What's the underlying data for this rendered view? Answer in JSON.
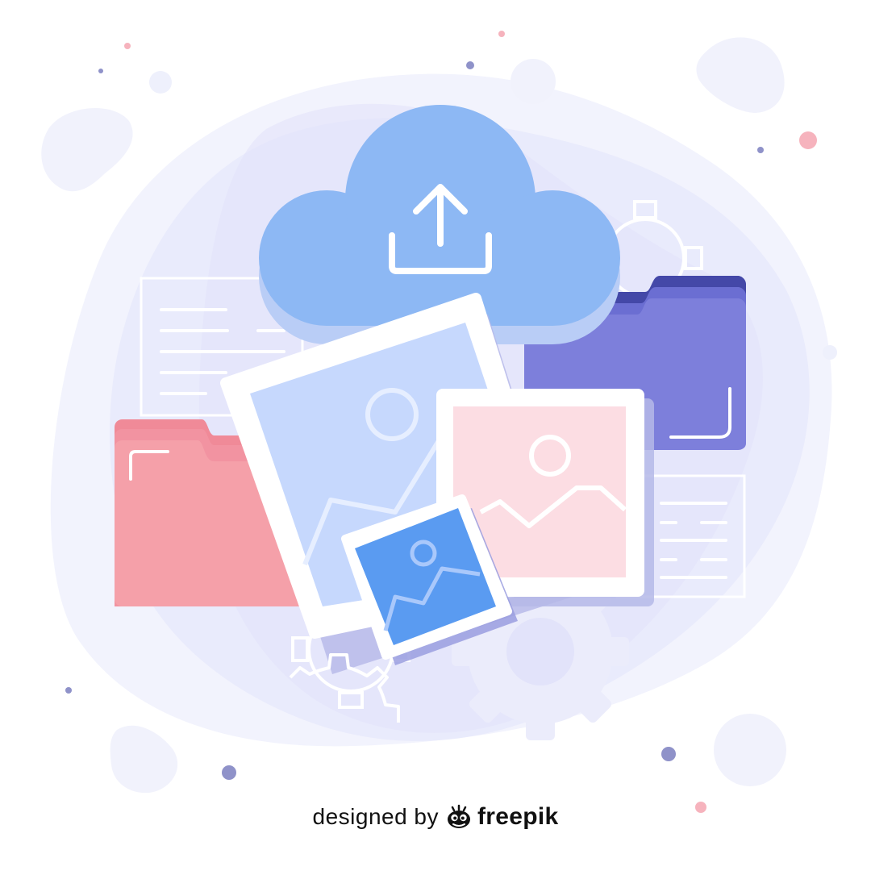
{
  "illustration": {
    "subject": "cloud-upload-with-folders-and-images",
    "icons": [
      "cloud-icon",
      "upload-arrow-icon",
      "folder-icon",
      "image-icon",
      "document-icon",
      "gear-icon"
    ],
    "colors": {
      "background": "#ffffff",
      "blob_light": "#f1f2fc",
      "blob_mid": "#e6e7fb",
      "cloud": "#8db8f4",
      "cloud_shadow": "#b9cdf6",
      "folder_pink": "#f5a0a9",
      "folder_pink_tab": "#f08a98",
      "folder_purple": "#7d7fdb",
      "folder_purple_tab": "#4448a8",
      "photo_blue_light": "#c6d8fd",
      "photo_pink": "#fcdde3",
      "photo_blue": "#5a9bf1",
      "photo_frame": "#ffffff",
      "dot_pink": "#f6b3bd",
      "dot_purple": "#8f92c9"
    }
  },
  "credit": {
    "prefix": "designed by",
    "brand": "freepik"
  }
}
